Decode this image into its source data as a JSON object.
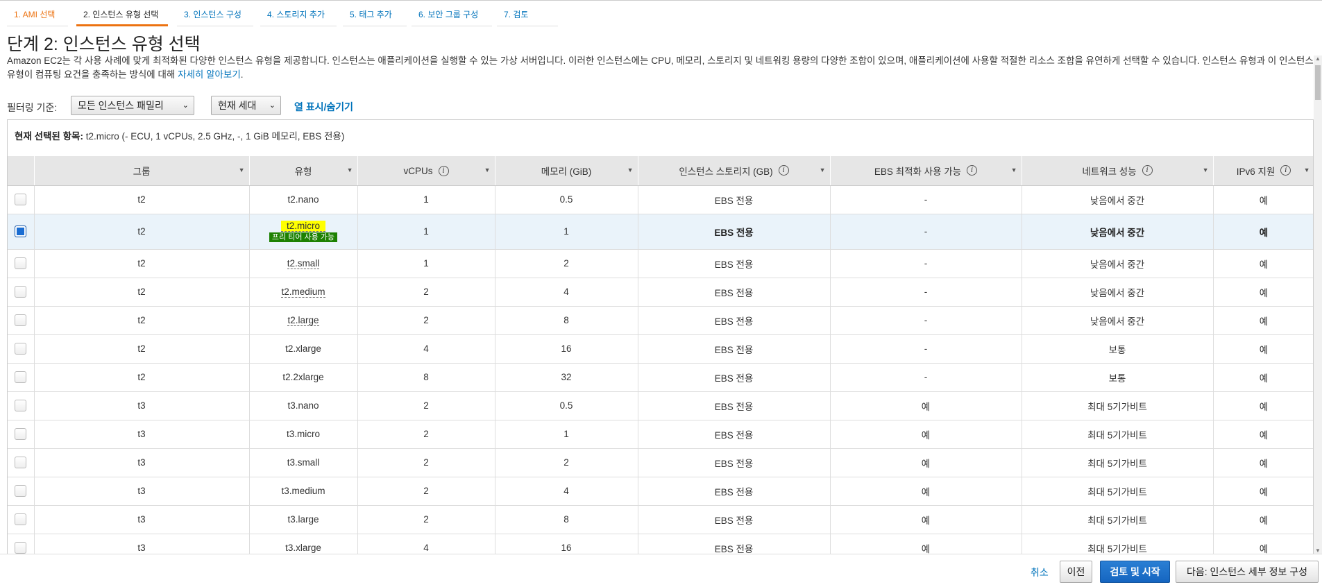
{
  "wizard": {
    "steps": [
      {
        "label": "1. AMI 선택",
        "state": "done"
      },
      {
        "label": "2. 인스턴스 유형 선택",
        "state": "active"
      },
      {
        "label": "3. 인스턴스 구성",
        "state": "pending"
      },
      {
        "label": "4. 스토리지 추가",
        "state": "pending"
      },
      {
        "label": "5. 태그 추가",
        "state": "pending"
      },
      {
        "label": "6. 보안 그룹 구성",
        "state": "pending"
      },
      {
        "label": "7. 검토",
        "state": "pending"
      }
    ]
  },
  "page": {
    "title": "단계 2: 인스턴스 유형 선택",
    "description": "Amazon EC2는 각 사용 사례에 맞게 최적화된 다양한 인스턴스 유형을 제공합니다. 인스턴스는 애플리케이션을 실행할 수 있는 가상 서버입니다. 이러한 인스턴스에는 CPU, 메모리, 스토리지 및 네트워킹 용량의 다양한 조합이 있으며, 애플리케이션에 사용할 적절한 리소스 조합을 유연하게 선택할 수 있습니다. 인스턴스 유형과 이 인스턴스 유형이 컴퓨팅 요건을 충족하는 방식에 대해 ",
    "learn_more": "자세히 알아보기",
    "desc_end": "."
  },
  "filter": {
    "label": "필터링 기준:",
    "family_select": "모든 인스턴스 패밀리",
    "generation_select": "현재 세대",
    "column_toggle": "열 표시/숨기기"
  },
  "selected": {
    "label": "현재 선택된 항목:",
    "value": " t2.micro (- ECU, 1 vCPUs, 2.5 GHz, -, 1 GiB 메모리, EBS 전용)"
  },
  "table": {
    "headers": {
      "group": "그룹",
      "type": "유형",
      "vcpus": "vCPUs",
      "memory": "메모리 (GiB)",
      "storage": "인스턴스 스토리지 (GB)",
      "ebs": "EBS 최적화 사용 가능",
      "network": "네트워크 성능",
      "ipv6": "IPv6 지원"
    },
    "free_tier_badge": "프리 티어 사용 가능",
    "rows": [
      {
        "group": "t2",
        "type": "t2.nano",
        "vcpus": "1",
        "memory": "0.5",
        "storage": "EBS 전용",
        "ebs": "-",
        "network": "낮음에서 중간",
        "ipv6": "예"
      },
      {
        "group": "t2",
        "type": "t2.micro",
        "vcpus": "1",
        "memory": "1",
        "storage": "EBS 전용",
        "ebs": "-",
        "network": "낮음에서 중간",
        "ipv6": "예"
      },
      {
        "group": "t2",
        "type": "t2.small",
        "vcpus": "1",
        "memory": "2",
        "storage": "EBS 전용",
        "ebs": "-",
        "network": "낮음에서 중간",
        "ipv6": "예"
      },
      {
        "group": "t2",
        "type": "t2.medium",
        "vcpus": "2",
        "memory": "4",
        "storage": "EBS 전용",
        "ebs": "-",
        "network": "낮음에서 중간",
        "ipv6": "예"
      },
      {
        "group": "t2",
        "type": "t2.large",
        "vcpus": "2",
        "memory": "8",
        "storage": "EBS 전용",
        "ebs": "-",
        "network": "낮음에서 중간",
        "ipv6": "예"
      },
      {
        "group": "t2",
        "type": "t2.xlarge",
        "vcpus": "4",
        "memory": "16",
        "storage": "EBS 전용",
        "ebs": "-",
        "network": "보통",
        "ipv6": "예"
      },
      {
        "group": "t2",
        "type": "t2.2xlarge",
        "vcpus": "8",
        "memory": "32",
        "storage": "EBS 전용",
        "ebs": "-",
        "network": "보통",
        "ipv6": "예"
      },
      {
        "group": "t3",
        "type": "t3.nano",
        "vcpus": "2",
        "memory": "0.5",
        "storage": "EBS 전용",
        "ebs": "예",
        "network": "최대 5기가비트",
        "ipv6": "예"
      },
      {
        "group": "t3",
        "type": "t3.micro",
        "vcpus": "2",
        "memory": "1",
        "storage": "EBS 전용",
        "ebs": "예",
        "network": "최대 5기가비트",
        "ipv6": "예"
      },
      {
        "group": "t3",
        "type": "t3.small",
        "vcpus": "2",
        "memory": "2",
        "storage": "EBS 전용",
        "ebs": "예",
        "network": "최대 5기가비트",
        "ipv6": "예"
      },
      {
        "group": "t3",
        "type": "t3.medium",
        "vcpus": "2",
        "memory": "4",
        "storage": "EBS 전용",
        "ebs": "예",
        "network": "최대 5기가비트",
        "ipv6": "예"
      },
      {
        "group": "t3",
        "type": "t3.large",
        "vcpus": "2",
        "memory": "8",
        "storage": "EBS 전용",
        "ebs": "예",
        "network": "최대 5기가비트",
        "ipv6": "예"
      },
      {
        "group": "t3",
        "type": "t3.xlarge",
        "vcpus": "4",
        "memory": "16",
        "storage": "EBS 전용",
        "ebs": "예",
        "network": "최대 5기가비트",
        "ipv6": "예"
      }
    ]
  },
  "footer": {
    "cancel": "취소",
    "previous": "이전",
    "review_launch": "검토 및 시작",
    "next": "다음: 인스턴스 세부 정보 구성"
  },
  "colors": {
    "accent_orange": "#ec7211",
    "link_blue": "#0073bb",
    "primary_button": "#1565c0",
    "free_tier_green": "#1d8102",
    "highlight_yellow": "#ffff00"
  }
}
